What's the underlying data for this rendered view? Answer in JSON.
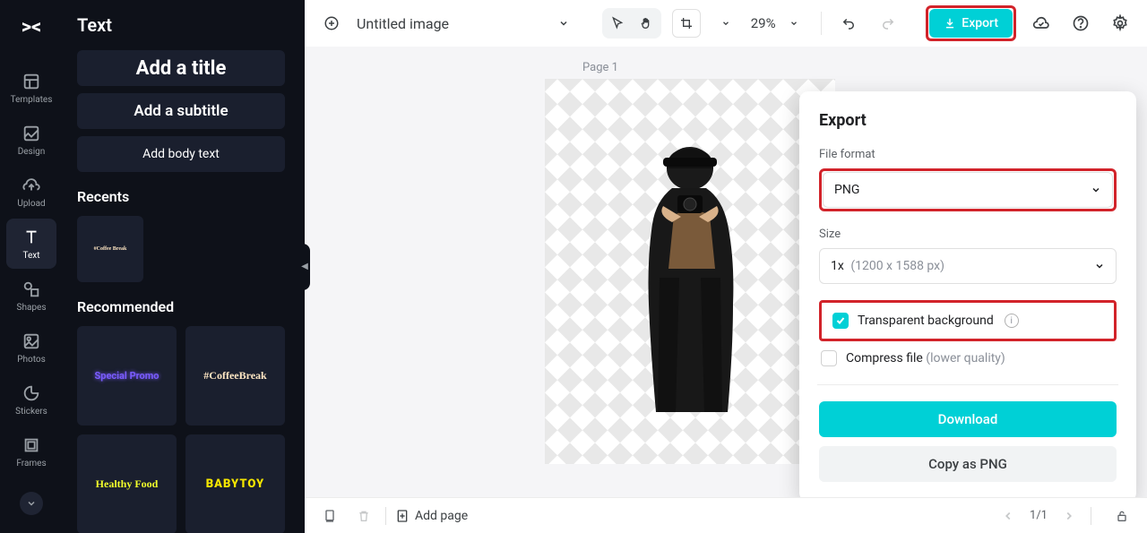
{
  "rail": {
    "items": [
      {
        "id": "templates",
        "label": "Templates"
      },
      {
        "id": "design",
        "label": "Design"
      },
      {
        "id": "upload",
        "label": "Upload"
      },
      {
        "id": "text",
        "label": "Text"
      },
      {
        "id": "shapes",
        "label": "Shapes"
      },
      {
        "id": "photos",
        "label": "Photos"
      },
      {
        "id": "stickers",
        "label": "Stickers"
      },
      {
        "id": "frames",
        "label": "Frames"
      }
    ],
    "active": "text"
  },
  "panel": {
    "title": "Text",
    "addTitle": "Add a title",
    "addSubtitle": "Add a subtitle",
    "addBody": "Add body text",
    "recentsHeader": "Recents",
    "recents": [
      {
        "label": "#Coffee Break"
      }
    ],
    "recommendedHeader": "Recommended",
    "recommended": [
      {
        "id": "special",
        "label": "Special Promo"
      },
      {
        "id": "coffee",
        "label": "#CoffeeBreak"
      },
      {
        "id": "healthy",
        "label": "Healthy Food"
      },
      {
        "id": "baby",
        "label": "BABYTOY"
      }
    ]
  },
  "toolbar": {
    "docTitle": "Untitled image",
    "zoom": "29%",
    "exportLabel": "Export"
  },
  "stage": {
    "pageLabel": "Page 1"
  },
  "bottom": {
    "addPage": "Add page",
    "pageCounter": "1/1"
  },
  "popover": {
    "title": "Export",
    "fileFormatLabel": "File format",
    "fileFormatValue": "PNG",
    "sizeLabel": "Size",
    "sizeValue": "1x",
    "sizeDim": "(1200 x 1588 px)",
    "transparentLabel": "Transparent background",
    "compressLabel": "Compress file",
    "compressHint": "(lower quality)",
    "downloadLabel": "Download",
    "copyLabel": "Copy as PNG"
  },
  "colors": {
    "accent": "#00d0d6",
    "highlight": "#d2232a"
  }
}
